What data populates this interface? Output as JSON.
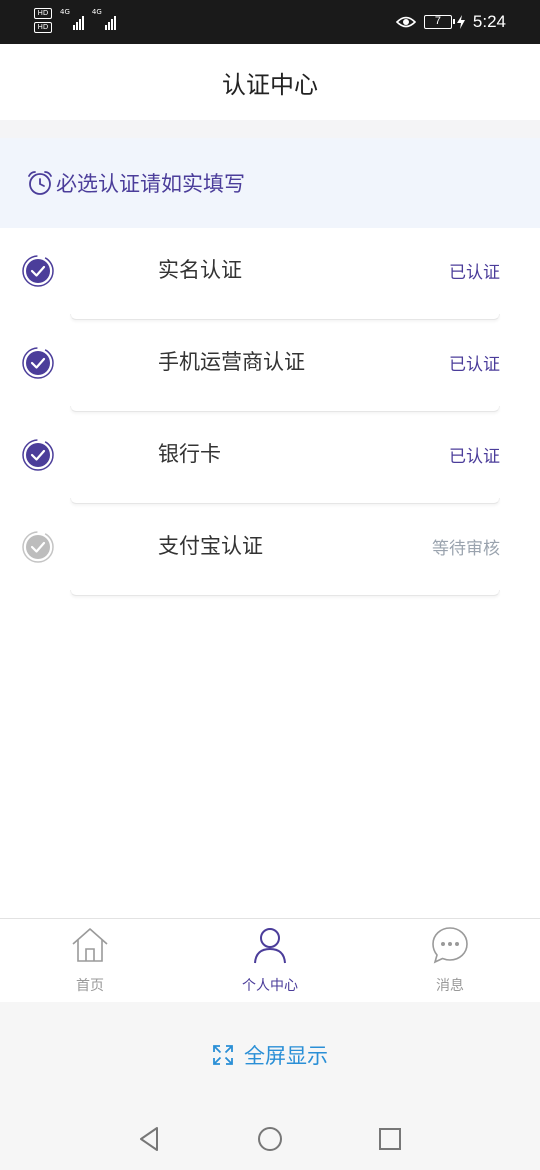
{
  "status_bar": {
    "sim1_badge": "HD",
    "sim2_badge": "HD",
    "net1": "4G",
    "net2": "4G",
    "battery": "7",
    "time": "5:24"
  },
  "header": {
    "title": "认证中心"
  },
  "notice": {
    "text": "必选认证请如实填写"
  },
  "items": [
    {
      "label": "实名认证",
      "status": "已认证",
      "verified": true
    },
    {
      "label": "手机运营商认证",
      "status": "已认证",
      "verified": true
    },
    {
      "label": "银行卡",
      "status": "已认证",
      "verified": true
    },
    {
      "label": "支付宝认证",
      "status": "等待审核",
      "verified": false
    }
  ],
  "tabs": [
    {
      "label": "首页",
      "icon": "home-icon",
      "active": false
    },
    {
      "label": "个人中心",
      "icon": "user-icon",
      "active": true
    },
    {
      "label": "消息",
      "icon": "chat-icon",
      "active": false
    }
  ],
  "fullscreen": {
    "label": "全屏显示",
    "icon": "expand-icon"
  },
  "colors": {
    "accent": "#4b3d9a",
    "pending": "#b9b9b9",
    "link_blue": "#2a8fd6",
    "notice_bg": "#f1f5fc"
  }
}
